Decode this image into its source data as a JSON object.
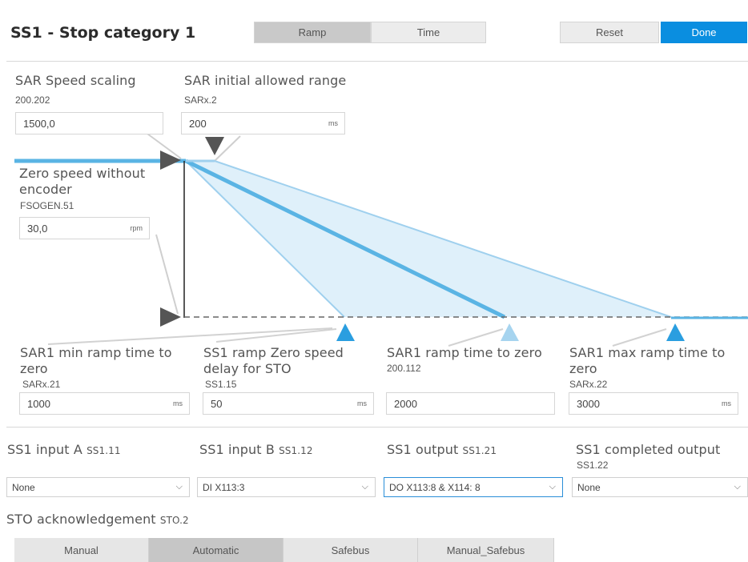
{
  "header": {
    "title": "SS1 - Stop category 1",
    "mode_tabs": [
      "Ramp",
      "Time"
    ],
    "active_mode": "Ramp",
    "reset_label": "Reset",
    "done_label": "Done"
  },
  "params": {
    "speed_scaling": {
      "label": "SAR Speed scaling",
      "code": "200.202",
      "value": "1500,0"
    },
    "initial_range": {
      "label": "SAR initial allowed range",
      "code": "SARx.2",
      "value": "200",
      "unit": "ms"
    },
    "zero_speed": {
      "label_line1": "Zero speed without",
      "label_line2": "encoder",
      "code": "FSOGEN.51",
      "value": "30,0",
      "unit": "rpm"
    },
    "min_ramp": {
      "label_line1": "SAR1 min ramp time to",
      "label_line2": "zero",
      "code": "SARx.21",
      "value": "1000",
      "unit": "ms"
    },
    "zero_delay": {
      "label_line1": "SS1 ramp Zero speed",
      "label_line2": "delay for STO",
      "code": "SS1.15",
      "value": "50",
      "unit": "ms"
    },
    "ramp_time": {
      "label": "SAR1 ramp time to zero",
      "code": "200.112",
      "value": "2000"
    },
    "max_ramp": {
      "label_line1": "SAR1 max ramp time to",
      "label_line2": "zero",
      "code": "SARx.22",
      "value": "3000",
      "unit": "ms"
    }
  },
  "io": {
    "input_a": {
      "label": "SS1 input A",
      "code": "SS1.11",
      "selected": "None"
    },
    "input_b": {
      "label": "SS1 input B",
      "code": "SS1.12",
      "selected": "DI X113:3"
    },
    "output": {
      "label": "SS1 output",
      "code": "SS1.21",
      "selected": "DO X113:8 & X114: 8"
    },
    "completed": {
      "label": "SS1 completed output",
      "code": "SS1.22",
      "selected": "None"
    }
  },
  "sto": {
    "label": "STO acknowledgement",
    "code": "STO.2",
    "options": [
      "Manual",
      "Automatic",
      "Safebus",
      "Manual_Safebus"
    ],
    "selected": "Automatic"
  },
  "colors": {
    "accent": "#0a8ee0",
    "ramp_line": "#5ab4e4",
    "ramp_fill": "#dceef9",
    "marker_light": "#a6d4ef",
    "marker_dark": "#555555"
  },
  "icons": {
    "dropdown": "chevron-down-icon",
    "marker_down": "triangle-down-icon",
    "marker_right": "triangle-right-icon",
    "marker_up": "triangle-up-icon"
  }
}
